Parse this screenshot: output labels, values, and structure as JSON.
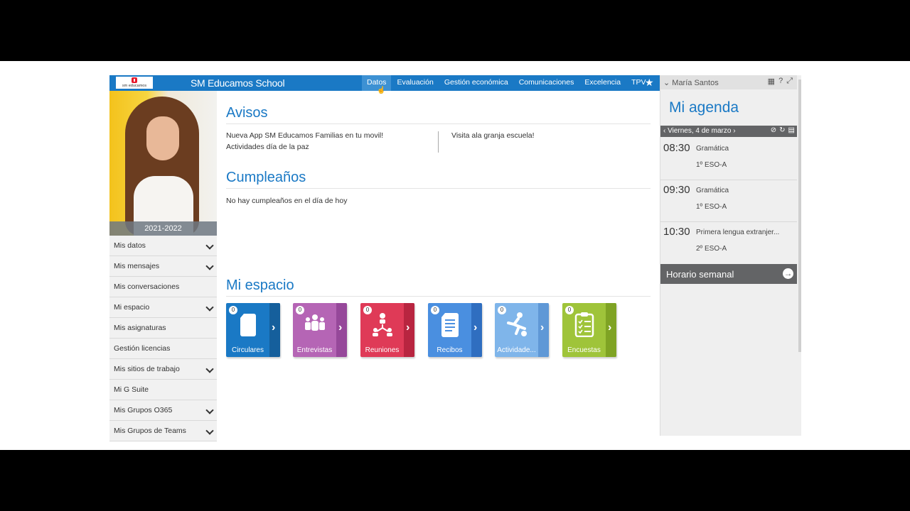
{
  "header": {
    "logo_text": "sm educamos",
    "app_title": "SM Educamos School",
    "nav": [
      "Datos",
      "Evaluación",
      "Gestión económica",
      "Comunicaciones",
      "Excelencia",
      "TPV"
    ]
  },
  "sidebar": {
    "year": "2021-2022",
    "items": [
      {
        "label": "Mis datos",
        "expandable": true
      },
      {
        "label": "Mis mensajes",
        "expandable": true
      },
      {
        "label": "Mis conversaciones",
        "expandable": false
      },
      {
        "label": "Mi espacio",
        "expandable": true
      },
      {
        "label": "Mis asignaturas",
        "expandable": false
      },
      {
        "label": "Gestión licencias",
        "expandable": false
      },
      {
        "label": "Mis sitios de trabajo",
        "expandable": true
      },
      {
        "label": "Mi G Suite",
        "expandable": false
      },
      {
        "label": "Mis Grupos O365",
        "expandable": true
      },
      {
        "label": "Mis Grupos de Teams",
        "expandable": true
      }
    ]
  },
  "main": {
    "avisos_title": "Avisos",
    "avisos_left": [
      "Nueva App SM Educamos Familias en tu movil!",
      "Actividades día de la paz"
    ],
    "avisos_right": [
      "Visita ala granja escuela!"
    ],
    "cumple_title": "Cumpleaños",
    "cumple_text": "No hay cumpleaños en el día de hoy",
    "espacio_title": "Mi espacio",
    "tiles": [
      {
        "label": "Circulares",
        "count": "0",
        "color": "#1a79c5",
        "side": "#155f9c",
        "icon": "document-icon"
      },
      {
        "label": "Entrevistas",
        "count": "0",
        "color": "#b565b5",
        "side": "#96489a",
        "icon": "people-icon"
      },
      {
        "label": "Reuniones",
        "count": "0",
        "color": "#df3a57",
        "side": "#b82540",
        "icon": "meeting-icon"
      },
      {
        "label": "Recibos",
        "count": "0",
        "color": "#4a8fe0",
        "side": "#2f6ec0",
        "icon": "receipt-icon"
      },
      {
        "label": "Actividade...",
        "count": "0",
        "color": "#7fb5ea",
        "side": "#5f98d6",
        "icon": "activity-icon"
      },
      {
        "label": "Encuestas",
        "count": "0",
        "color": "#9fc43a",
        "side": "#7fa324",
        "icon": "survey-icon"
      }
    ]
  },
  "agenda": {
    "user": "María Santos",
    "title": "Mi agenda",
    "date": "Viernes, 4 de marzo",
    "events": [
      {
        "time": "08:30",
        "subject": "Gramática",
        "group": "1º ESO-A"
      },
      {
        "time": "09:30",
        "subject": "Gramática",
        "group": "1º ESO-A"
      },
      {
        "time": "10:30",
        "subject": "Primera lengua extranjer...",
        "group": "2º ESO-A"
      }
    ],
    "horario": "Horario semanal"
  }
}
